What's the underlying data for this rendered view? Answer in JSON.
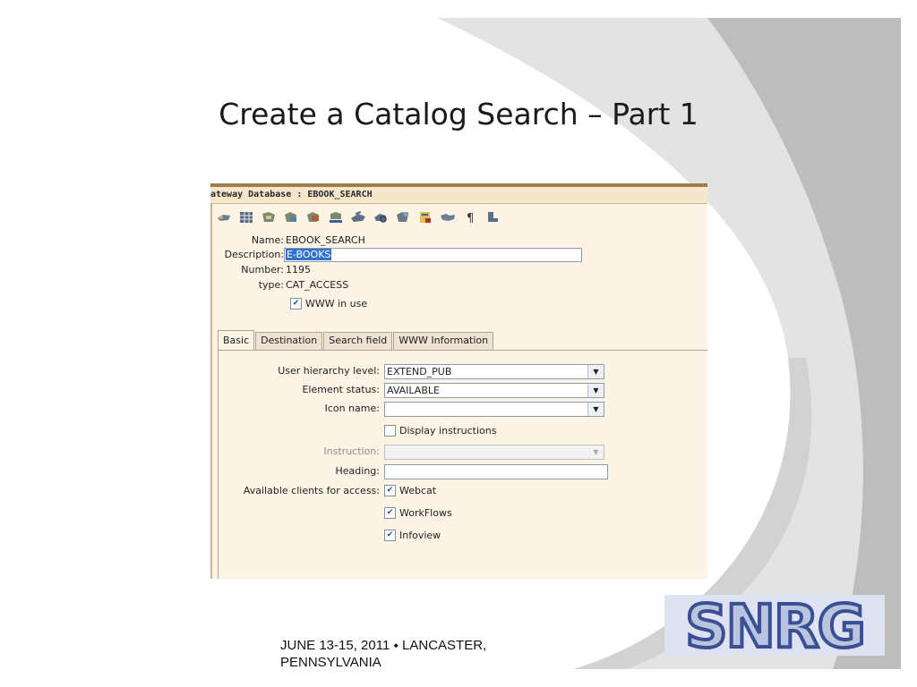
{
  "slide": {
    "title": "Create a Catalog Search – Part 1",
    "footer": "JUNE 13-15, 2011 ⬩ LANCASTER, PENNSYLVANIA",
    "logo_text": "SNRG",
    "colors": {
      "swoosh_light": "#e3e3e3",
      "swoosh_dark": "#bdbdbd",
      "logo_blue": "#3a4f94"
    }
  },
  "window": {
    "title": "ateway Database : EBOOK_SEARCH",
    "toolbar_icons": [
      "lookup-icon",
      "grid-icon",
      "record-icon",
      "record-copy-icon",
      "record-edit-icon",
      "record-save-icon",
      "transfer-icon",
      "search-icon",
      "export-icon",
      "report-icon",
      "handshake-icon",
      "paragraph-icon",
      "exit-icon"
    ],
    "fields": {
      "name_label": "Name:",
      "name_value": "EBOOK_SEARCH",
      "description_label": "Description:",
      "description_value": "E-BOOKS",
      "number_label": "Number:",
      "number_value": "1195",
      "type_label": "type:",
      "type_value": "CAT_ACCESS",
      "www_in_use_label": "WWW in use",
      "www_in_use_checked": true
    },
    "tabs": [
      {
        "label": "Basic",
        "active": true
      },
      {
        "label": "Destination",
        "active": false
      },
      {
        "label": "Search field",
        "active": false
      },
      {
        "label": "WWW Information",
        "active": false
      }
    ],
    "basic": {
      "user_hierarchy_label": "User hierarchy level:",
      "user_hierarchy_value": "EXTEND_PUB",
      "element_status_label": "Element status:",
      "element_status_value": "AVAILABLE",
      "icon_name_label": "Icon name:",
      "icon_name_value": "",
      "display_instructions_label": "Display instructions",
      "display_instructions_checked": false,
      "instruction_label": "Instruction:",
      "instruction_value": "",
      "heading_label": "Heading:",
      "heading_value": "",
      "clients_label": "Available clients for access:",
      "clients": [
        {
          "label": "Webcat",
          "checked": true
        },
        {
          "label": "WorkFlows",
          "checked": true
        },
        {
          "label": "Infoview",
          "checked": true
        }
      ]
    }
  }
}
